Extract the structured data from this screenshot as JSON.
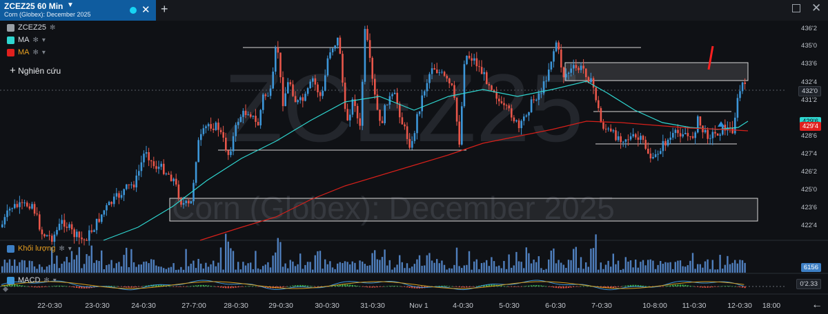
{
  "tab": {
    "title": "ZCEZ25 60 Min",
    "subtitle": "Corn (Globex): December 2025"
  },
  "watermark": {
    "symbol": "ZCEZ25",
    "name": "Corn (Globex): December 2025"
  },
  "legend": [
    {
      "label": "ZCEZ25",
      "color": "#9aa0a6"
    },
    {
      "label": "MA",
      "color": "#2fd6d0"
    },
    {
      "label": "MA",
      "color": "#e0201e"
    }
  ],
  "research_label": "Nghiên cứu",
  "volume_label": "Khối lượng",
  "macd_label": "MACD",
  "price_axis": [
    "436'2",
    "435'0",
    "433'6",
    "432'4",
    "431'2",
    "428'6",
    "427'4",
    "426'2",
    "425'0",
    "423'6",
    "422'4"
  ],
  "price_tags": {
    "last": "432'0",
    "ma_fast": "429'6",
    "ma_slow": "429'4",
    "volume": "6156",
    "macd": "0'2.33"
  },
  "dates": [
    "22-0:30",
    "23-0:30",
    "24-0:30",
    "27-7:00",
    "28-0:30",
    "29-0:30",
    "30-0:30",
    "31-0:30",
    "Nov 1",
    "4-0:30",
    "5-0:30",
    "6-0:30",
    "7-0:30",
    "10-8:00",
    "11-0:30",
    "12-0:30",
    "18:00"
  ],
  "colors": {
    "up": "#3d96d8",
    "down": "#e8564a",
    "ma_fast": "#2fd6d0",
    "ma_slow": "#d8201a",
    "box": "#d8d8d8"
  },
  "chart_data": {
    "type": "candlestick",
    "title": "ZCEZ25 60 Min",
    "series": [
      {
        "name": "ZCEZ25"
      },
      {
        "name": "MA"
      },
      {
        "name": "MA"
      }
    ],
    "y_ticks": [
      "436'2",
      "435'0",
      "433'6",
      "432'4",
      "431'2",
      "428'6",
      "427'4",
      "426'2",
      "425'0",
      "423'6",
      "422'4"
    ],
    "x_ticks": [
      "22-0:30",
      "23-0:30",
      "24-0:30",
      "27-7:00",
      "28-0:30",
      "29-0:30",
      "30-0:30",
      "31-0:30",
      "Nov 1",
      "4-0:30",
      "5-0:30",
      "6-0:30",
      "7-0:30",
      "10-8:00",
      "11-0:30",
      "12-0:30",
      "18:00"
    ],
    "last_price": "432'0"
  }
}
